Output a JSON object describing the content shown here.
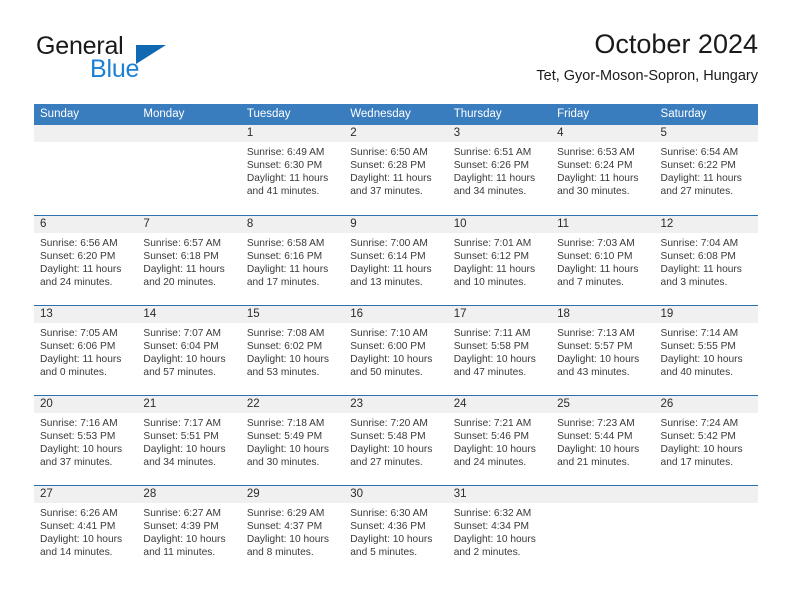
{
  "brand": {
    "name_part1": "General",
    "name_part2": "Blue",
    "logo_icon": "triangle-flag-icon"
  },
  "header": {
    "title": "October 2024",
    "subtitle": "Tet, Gyor-Moson-Sopron, Hungary"
  },
  "colors": {
    "header_bar": "#3a7dbf",
    "row_divider": "#2f6fae",
    "day_number_band": "#f0f0f0",
    "brand_blue": "#1b7fd4",
    "logo_triangle": "#1168b3",
    "text": "#3a3a3a"
  },
  "weekdays": [
    "Sunday",
    "Monday",
    "Tuesday",
    "Wednesday",
    "Thursday",
    "Friday",
    "Saturday"
  ],
  "weeks": [
    [
      {
        "day": "",
        "empty": true
      },
      {
        "day": "",
        "empty": true
      },
      {
        "day": "1",
        "sunrise": "Sunrise: 6:49 AM",
        "sunset": "Sunset: 6:30 PM",
        "daylight_1": "Daylight: 11 hours",
        "daylight_2": "and 41 minutes."
      },
      {
        "day": "2",
        "sunrise": "Sunrise: 6:50 AM",
        "sunset": "Sunset: 6:28 PM",
        "daylight_1": "Daylight: 11 hours",
        "daylight_2": "and 37 minutes."
      },
      {
        "day": "3",
        "sunrise": "Sunrise: 6:51 AM",
        "sunset": "Sunset: 6:26 PM",
        "daylight_1": "Daylight: 11 hours",
        "daylight_2": "and 34 minutes."
      },
      {
        "day": "4",
        "sunrise": "Sunrise: 6:53 AM",
        "sunset": "Sunset: 6:24 PM",
        "daylight_1": "Daylight: 11 hours",
        "daylight_2": "and 30 minutes."
      },
      {
        "day": "5",
        "sunrise": "Sunrise: 6:54 AM",
        "sunset": "Sunset: 6:22 PM",
        "daylight_1": "Daylight: 11 hours",
        "daylight_2": "and 27 minutes."
      }
    ],
    [
      {
        "day": "6",
        "sunrise": "Sunrise: 6:56 AM",
        "sunset": "Sunset: 6:20 PM",
        "daylight_1": "Daylight: 11 hours",
        "daylight_2": "and 24 minutes."
      },
      {
        "day": "7",
        "sunrise": "Sunrise: 6:57 AM",
        "sunset": "Sunset: 6:18 PM",
        "daylight_1": "Daylight: 11 hours",
        "daylight_2": "and 20 minutes."
      },
      {
        "day": "8",
        "sunrise": "Sunrise: 6:58 AM",
        "sunset": "Sunset: 6:16 PM",
        "daylight_1": "Daylight: 11 hours",
        "daylight_2": "and 17 minutes."
      },
      {
        "day": "9",
        "sunrise": "Sunrise: 7:00 AM",
        "sunset": "Sunset: 6:14 PM",
        "daylight_1": "Daylight: 11 hours",
        "daylight_2": "and 13 minutes."
      },
      {
        "day": "10",
        "sunrise": "Sunrise: 7:01 AM",
        "sunset": "Sunset: 6:12 PM",
        "daylight_1": "Daylight: 11 hours",
        "daylight_2": "and 10 minutes."
      },
      {
        "day": "11",
        "sunrise": "Sunrise: 7:03 AM",
        "sunset": "Sunset: 6:10 PM",
        "daylight_1": "Daylight: 11 hours",
        "daylight_2": "and 7 minutes."
      },
      {
        "day": "12",
        "sunrise": "Sunrise: 7:04 AM",
        "sunset": "Sunset: 6:08 PM",
        "daylight_1": "Daylight: 11 hours",
        "daylight_2": "and 3 minutes."
      }
    ],
    [
      {
        "day": "13",
        "sunrise": "Sunrise: 7:05 AM",
        "sunset": "Sunset: 6:06 PM",
        "daylight_1": "Daylight: 11 hours",
        "daylight_2": "and 0 minutes."
      },
      {
        "day": "14",
        "sunrise": "Sunrise: 7:07 AM",
        "sunset": "Sunset: 6:04 PM",
        "daylight_1": "Daylight: 10 hours",
        "daylight_2": "and 57 minutes."
      },
      {
        "day": "15",
        "sunrise": "Sunrise: 7:08 AM",
        "sunset": "Sunset: 6:02 PM",
        "daylight_1": "Daylight: 10 hours",
        "daylight_2": "and 53 minutes."
      },
      {
        "day": "16",
        "sunrise": "Sunrise: 7:10 AM",
        "sunset": "Sunset: 6:00 PM",
        "daylight_1": "Daylight: 10 hours",
        "daylight_2": "and 50 minutes."
      },
      {
        "day": "17",
        "sunrise": "Sunrise: 7:11 AM",
        "sunset": "Sunset: 5:58 PM",
        "daylight_1": "Daylight: 10 hours",
        "daylight_2": "and 47 minutes."
      },
      {
        "day": "18",
        "sunrise": "Sunrise: 7:13 AM",
        "sunset": "Sunset: 5:57 PM",
        "daylight_1": "Daylight: 10 hours",
        "daylight_2": "and 43 minutes."
      },
      {
        "day": "19",
        "sunrise": "Sunrise: 7:14 AM",
        "sunset": "Sunset: 5:55 PM",
        "daylight_1": "Daylight: 10 hours",
        "daylight_2": "and 40 minutes."
      }
    ],
    [
      {
        "day": "20",
        "sunrise": "Sunrise: 7:16 AM",
        "sunset": "Sunset: 5:53 PM",
        "daylight_1": "Daylight: 10 hours",
        "daylight_2": "and 37 minutes."
      },
      {
        "day": "21",
        "sunrise": "Sunrise: 7:17 AM",
        "sunset": "Sunset: 5:51 PM",
        "daylight_1": "Daylight: 10 hours",
        "daylight_2": "and 34 minutes."
      },
      {
        "day": "22",
        "sunrise": "Sunrise: 7:18 AM",
        "sunset": "Sunset: 5:49 PM",
        "daylight_1": "Daylight: 10 hours",
        "daylight_2": "and 30 minutes."
      },
      {
        "day": "23",
        "sunrise": "Sunrise: 7:20 AM",
        "sunset": "Sunset: 5:48 PM",
        "daylight_1": "Daylight: 10 hours",
        "daylight_2": "and 27 minutes."
      },
      {
        "day": "24",
        "sunrise": "Sunrise: 7:21 AM",
        "sunset": "Sunset: 5:46 PM",
        "daylight_1": "Daylight: 10 hours",
        "daylight_2": "and 24 minutes."
      },
      {
        "day": "25",
        "sunrise": "Sunrise: 7:23 AM",
        "sunset": "Sunset: 5:44 PM",
        "daylight_1": "Daylight: 10 hours",
        "daylight_2": "and 21 minutes."
      },
      {
        "day": "26",
        "sunrise": "Sunrise: 7:24 AM",
        "sunset": "Sunset: 5:42 PM",
        "daylight_1": "Daylight: 10 hours",
        "daylight_2": "and 17 minutes."
      }
    ],
    [
      {
        "day": "27",
        "sunrise": "Sunrise: 6:26 AM",
        "sunset": "Sunset: 4:41 PM",
        "daylight_1": "Daylight: 10 hours",
        "daylight_2": "and 14 minutes."
      },
      {
        "day": "28",
        "sunrise": "Sunrise: 6:27 AM",
        "sunset": "Sunset: 4:39 PM",
        "daylight_1": "Daylight: 10 hours",
        "daylight_2": "and 11 minutes."
      },
      {
        "day": "29",
        "sunrise": "Sunrise: 6:29 AM",
        "sunset": "Sunset: 4:37 PM",
        "daylight_1": "Daylight: 10 hours",
        "daylight_2": "and 8 minutes."
      },
      {
        "day": "30",
        "sunrise": "Sunrise: 6:30 AM",
        "sunset": "Sunset: 4:36 PM",
        "daylight_1": "Daylight: 10 hours",
        "daylight_2": "and 5 minutes."
      },
      {
        "day": "31",
        "sunrise": "Sunrise: 6:32 AM",
        "sunset": "Sunset: 4:34 PM",
        "daylight_1": "Daylight: 10 hours",
        "daylight_2": "and 2 minutes."
      },
      {
        "day": "",
        "empty": true
      },
      {
        "day": "",
        "empty": true
      }
    ]
  ]
}
